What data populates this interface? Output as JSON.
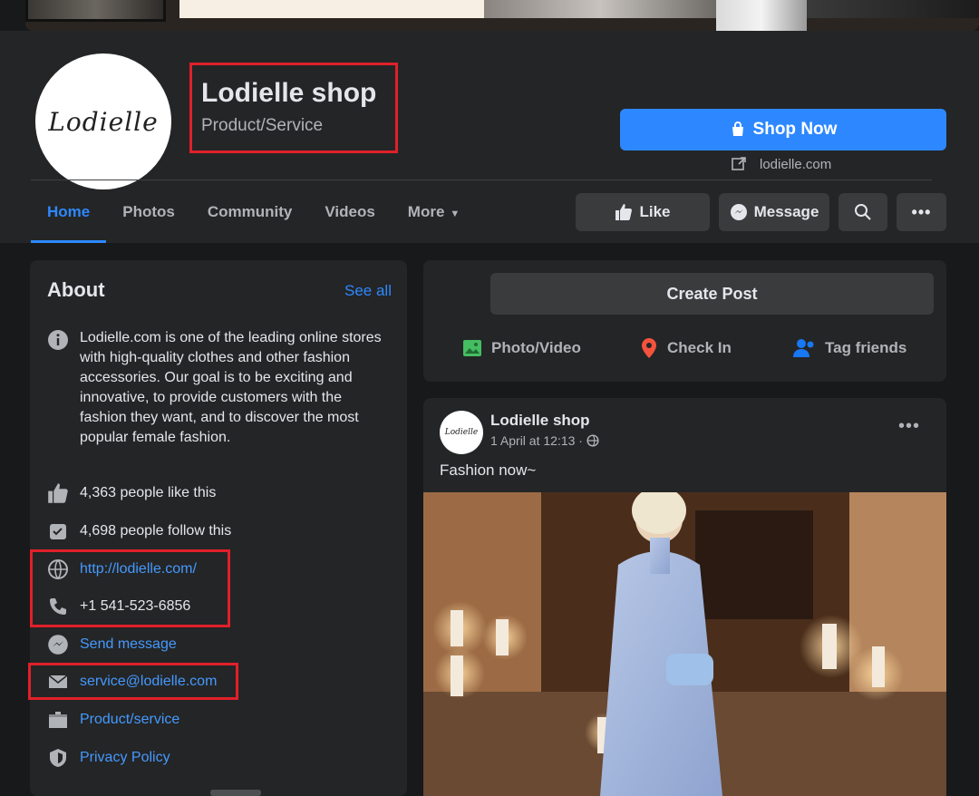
{
  "page": {
    "avatar_text": "Lodielle",
    "name": "Lodielle shop",
    "category": "Product/Service",
    "cta_label": "Shop Now",
    "website_short": "lodielle.com"
  },
  "tabs": [
    {
      "label": "Home",
      "active": true
    },
    {
      "label": "Photos"
    },
    {
      "label": "Community"
    },
    {
      "label": "Videos"
    },
    {
      "label": "More"
    }
  ],
  "actions": {
    "like": "Like",
    "message": "Message",
    "search_icon": "search-icon",
    "more_icon": "more-icon"
  },
  "about": {
    "title": "About",
    "see_all": "See all",
    "description": "Lodielle.com is one of the leading online stores with high-quality clothes and other fashion accessories. Our goal is to be exciting and innovative, to provide customers with the fashion they want, and to discover the most popular female fashion.",
    "likes": "4,363 people like this",
    "follows": "4,698 people follow this",
    "website": "http://lodielle.com/",
    "phone": "+1 541-523-6856",
    "send_message": "Send message",
    "email": "service@lodielle.com",
    "category": "Product/service",
    "privacy": "Privacy Policy"
  },
  "create_post": {
    "button": "Create Post",
    "photo_video": "Photo/Video",
    "check_in": "Check In",
    "tag_friends": "Tag friends"
  },
  "post": {
    "author": "Lodielle shop",
    "time": "1 April at 12:13 ·",
    "text": "Fashion now~",
    "avatar_text": "Lodielle"
  },
  "colors": {
    "accent": "#2d88ff",
    "highlight": "#e0202a",
    "card": "#242526",
    "background": "#18191a"
  }
}
